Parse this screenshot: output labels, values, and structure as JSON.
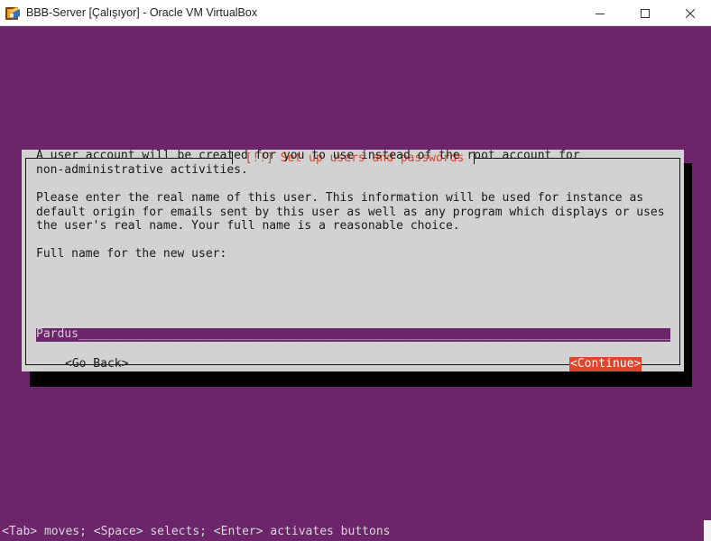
{
  "window": {
    "title": "BBB-Server [Çalışıyor] - Oracle VM VirtualBox",
    "app_icon": "virtualbox-icon",
    "controls": [
      "minimize-icon",
      "maximize-icon",
      "close-icon"
    ]
  },
  "colors": {
    "background": "#6c246b",
    "dialog": "#d2d2d2",
    "accent": "#e0452a"
  },
  "dialog": {
    "title": "[!!] Set up users and passwords",
    "paragraph1": "A user account will be created for you to use instead of the root account for\nnon-administrative activities.",
    "paragraph2": "Please enter the real name of this user. This information will be used for instance as\ndefault origin for emails sent by this user as well as any program which displays or uses\nthe user's real name. Your full name is a reasonable choice.",
    "prompt": "Full name for the new user:",
    "input_value": "Pardus",
    "input_fill": "__________________________________________________________________________________________________________",
    "go_back": "<Go Back>",
    "continue": "<Continue>"
  },
  "footer": {
    "hint": "<Tab> moves; <Space> selects; <Enter> activates buttons"
  }
}
